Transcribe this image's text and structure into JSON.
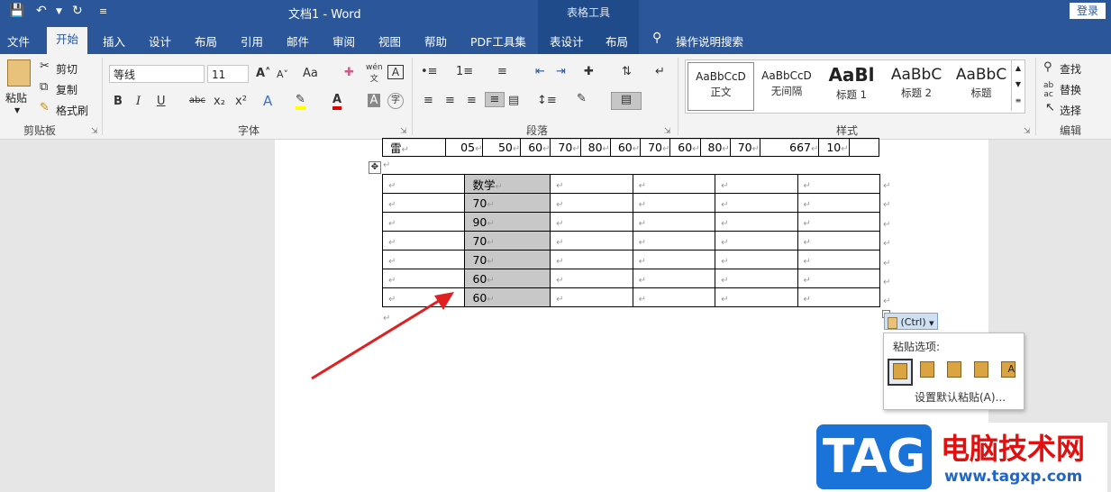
{
  "titlebar": {
    "doc_title": "文档1 - Word",
    "context_tab_group": "表格工具",
    "login_label": "登录"
  },
  "tabs": [
    "文件",
    "开始",
    "插入",
    "设计",
    "布局",
    "引用",
    "邮件",
    "审阅",
    "视图",
    "帮助",
    "PDF工具集",
    "表设计",
    "布局"
  ],
  "active_tab": "开始",
  "tell_me": "操作说明搜索",
  "clipboard": {
    "paste": "粘贴",
    "cut": "剪切",
    "copy": "复制",
    "format_painter": "格式刷",
    "label": "剪贴板"
  },
  "font": {
    "name": "等线",
    "size": "11",
    "label": "字体"
  },
  "paragraph": {
    "label": "段落"
  },
  "styles": {
    "label": "样式",
    "items": [
      {
        "preview": "AaBbCcD",
        "name": "正文"
      },
      {
        "preview": "AaBbCcD",
        "name": "无间隔"
      },
      {
        "preview": "AaBl",
        "name": "标题 1"
      },
      {
        "preview": "AaBbC",
        "name": "标题 2"
      },
      {
        "preview": "AaBbC",
        "name": "标题"
      }
    ]
  },
  "editing": {
    "find": "查找",
    "replace": "替换",
    "select": "选择",
    "label": "编辑"
  },
  "top_table_row": [
    "雷",
    "05",
    "50",
    "60",
    "70",
    "80",
    "60",
    "70",
    "60",
    "80",
    "70",
    "667",
    "10"
  ],
  "table": {
    "header": "数学",
    "values": [
      "70",
      "90",
      "70",
      "70",
      "60",
      "60"
    ]
  },
  "paste_ctrl": "(Ctrl)",
  "paste_popup": {
    "title": "粘贴选项:",
    "set_default": "设置默认粘贴(A)..."
  },
  "watermark": {
    "logo": "TAG",
    "site_name": "电脑技术网",
    "url": "www.tagxp.com"
  },
  "colors": {
    "ribbon_blue": "#2b579a",
    "selection_gray": "#c8c8c8",
    "arrow_red": "#e02020"
  }
}
